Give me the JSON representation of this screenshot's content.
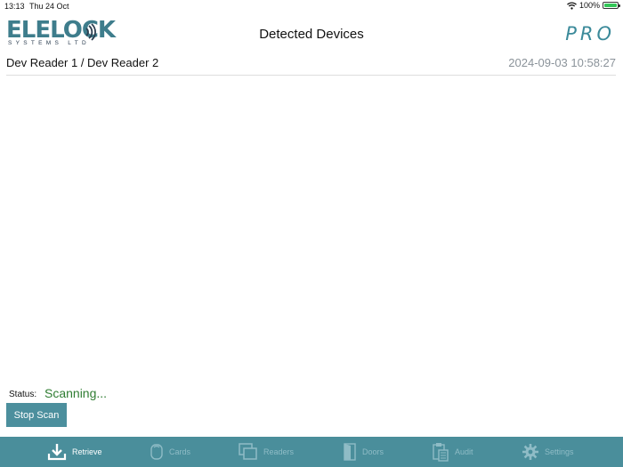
{
  "status_bar": {
    "time": "13:13",
    "date": "Thu 24 Oct",
    "battery": "100%",
    "icons": [
      "wifi-icon",
      "battery-charging-icon"
    ]
  },
  "header": {
    "logo_word": "ELELOCK",
    "logo_sub": "SYSTEMS LTD",
    "title": "Detected Devices",
    "badge": "PRO"
  },
  "device": {
    "readers": "Dev Reader 1 / Dev Reader 2",
    "timestamp": "2024-09-03 10:58:27"
  },
  "status": {
    "label": "Status:",
    "value": "Scanning...",
    "value_color": "#2f7d32"
  },
  "actions": {
    "stop_scan": "Stop Scan"
  },
  "tabbar": {
    "background": "#4a8e9b",
    "active": "Retrieve",
    "tabs": [
      {
        "label": "Retrieve",
        "icon": "download-tray-icon"
      },
      {
        "label": "Cards",
        "icon": "card-icon"
      },
      {
        "label": "Readers",
        "icon": "stacked-windows-icon"
      },
      {
        "label": "Doors",
        "icon": "door-icon"
      },
      {
        "label": "Audit",
        "icon": "clipboard-icon"
      },
      {
        "label": "Settings",
        "icon": "gear-icon"
      }
    ]
  }
}
